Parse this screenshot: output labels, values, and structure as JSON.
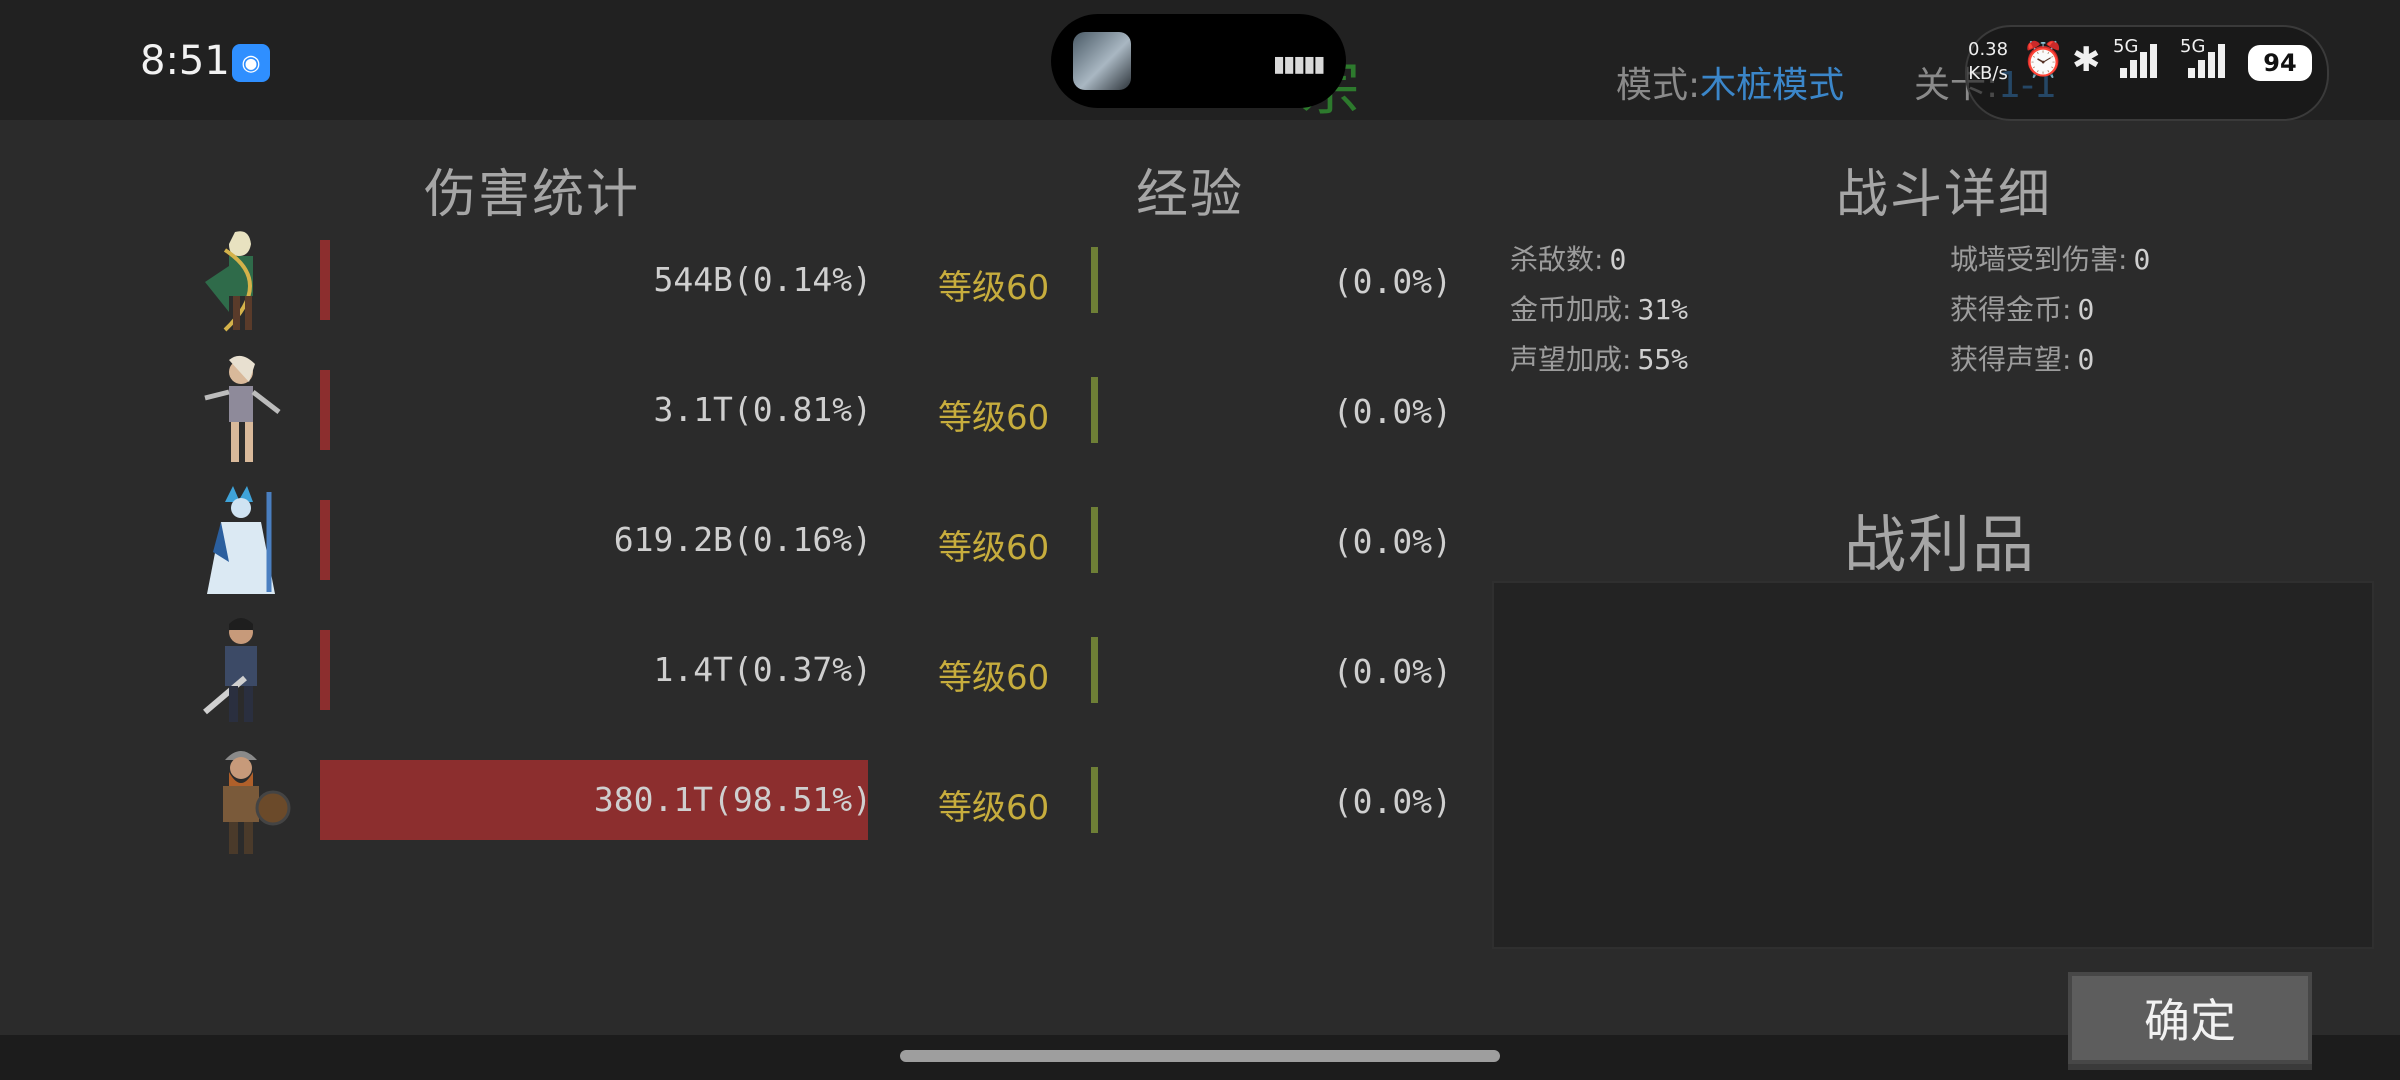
{
  "status_bar": {
    "time": "8:51",
    "net_speed_value": "0.38",
    "net_speed_unit": "KB/s",
    "network_1": "5G",
    "network_2": "5G",
    "battery": "94"
  },
  "header": {
    "bg_title": "宗",
    "mode_label": "模式:",
    "mode_value": "木桩模式",
    "stage_label": "关卡:",
    "stage_value": "1-1"
  },
  "damage": {
    "title": "伤害统计",
    "rows": [
      {
        "damage_text": "544B(0.14%)",
        "share_percent": 0.14
      },
      {
        "damage_text": "3.1T(0.81%)",
        "share_percent": 0.81
      },
      {
        "damage_text": "619.2B(0.16%)",
        "share_percent": 0.16
      },
      {
        "damage_text": "1.4T(0.37%)",
        "share_percent": 0.37
      },
      {
        "damage_text": "380.1T(98.51%)",
        "share_percent": 98.51
      }
    ]
  },
  "experience": {
    "title": "经验",
    "rows": [
      {
        "level": "等级60",
        "exp_text": "(0.0%)"
      },
      {
        "level": "等级60",
        "exp_text": "(0.0%)"
      },
      {
        "level": "等级60",
        "exp_text": "(0.0%)"
      },
      {
        "level": "等级60",
        "exp_text": "(0.0%)"
      },
      {
        "level": "等级60",
        "exp_text": "(0.0%)"
      }
    ]
  },
  "battle_details": {
    "title": "战斗详细",
    "kills_label": "杀敌数:",
    "kills_value": "0",
    "gold_bonus_label": "金币加成:",
    "gold_bonus_value": "31%",
    "fame_bonus_label": "声望加成:",
    "fame_bonus_value": "55%",
    "wall_damage_label": "城墙受到伤害:",
    "wall_damage_value": "0",
    "gold_gain_label": "获得金币:",
    "gold_gain_value": "0",
    "fame_gain_label": "获得声望:",
    "fame_gain_value": "0"
  },
  "loot": {
    "title": "战利品"
  },
  "confirm_button": "确定",
  "colors": {
    "damage_bar": "#8c2e2e",
    "level_text": "#c7ad3d",
    "exp_bar": "#6e7f36",
    "mode_value": "#3b86c9"
  },
  "heroes": [
    "elf-archer-icon",
    "warrior-woman-icon",
    "ice-mage-icon",
    "armored-swordsman-icon",
    "viking-warrior-icon"
  ]
}
